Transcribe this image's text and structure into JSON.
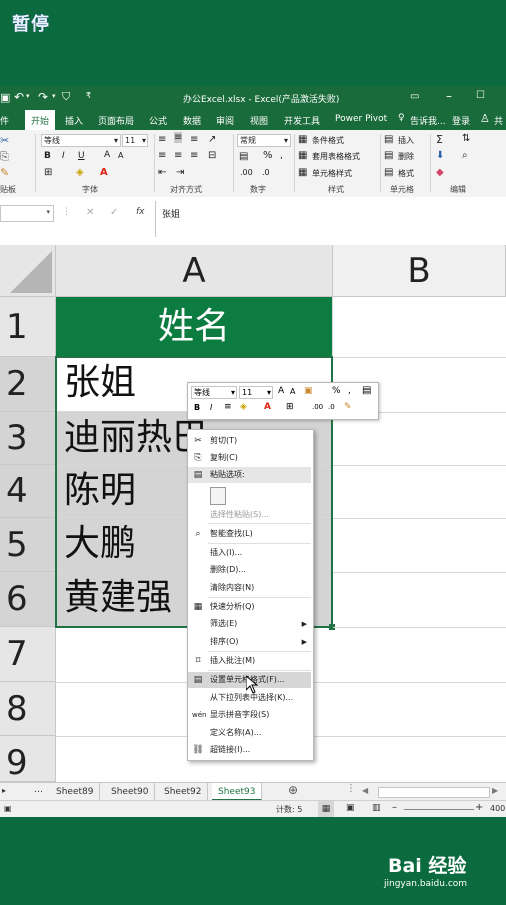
{
  "overlay": {
    "paused_label": "暂停"
  },
  "titlebar": {
    "title": "办公Excel.xlsx - Excel(产品激活失败)"
  },
  "tabs": {
    "items": [
      "件",
      "开始",
      "插入",
      "页面布局",
      "公式",
      "数据",
      "审阅",
      "视图",
      "开发工具",
      "Power Pivot"
    ],
    "tell_me": "告诉我...",
    "login": "登录",
    "share": "共"
  },
  "ribbon": {
    "font_name": "等线",
    "font_size": "11",
    "number_format": "常规",
    "cond_format": "条件格式",
    "table_format": "套用表格格式",
    "cell_style": "单元格样式",
    "insert": "插入",
    "delete": "删除",
    "format": "格式",
    "groups": [
      "贴板",
      "字体",
      "对齐方式",
      "数字",
      "样式",
      "单元格",
      "编辑"
    ]
  },
  "formula_bar": {
    "fx": "fx",
    "value": "张姐"
  },
  "grid": {
    "col_a": "A",
    "col_b": "B",
    "rows": [
      "1",
      "2",
      "3",
      "4",
      "5",
      "6",
      "7",
      "8",
      "9"
    ],
    "cells": [
      "姓名",
      "张姐",
      "迪丽热巴",
      "陈明",
      "大鹏",
      "黄建强"
    ]
  },
  "mini_toolbar": {
    "font": "等线",
    "size": "11",
    "percent": "%"
  },
  "context_menu": {
    "items": [
      "剪切(T)",
      "复制(C)",
      "粘贴选项:",
      "选择性粘贴(S)...",
      "智能查找(L)",
      "插入(I)...",
      "删除(D)...",
      "清除内容(N)",
      "快速分析(Q)",
      "筛选(E)",
      "排序(O)",
      "插入批注(M)",
      "设置单元格格式(F)...",
      "从下拉列表中选择(K)...",
      "显示拼音字段(S)",
      "定义名称(A)...",
      "超链接(I)..."
    ]
  },
  "sheets": {
    "tabs": [
      "Sheet89",
      "Sheet90",
      "Sheet92",
      "Sheet93"
    ],
    "active": "Sheet93"
  },
  "status": {
    "count": "计数: 5",
    "zoom": "400"
  },
  "watermark": {
    "brand": "Bai 经验",
    "url": "jingyan.baidu.com"
  }
}
